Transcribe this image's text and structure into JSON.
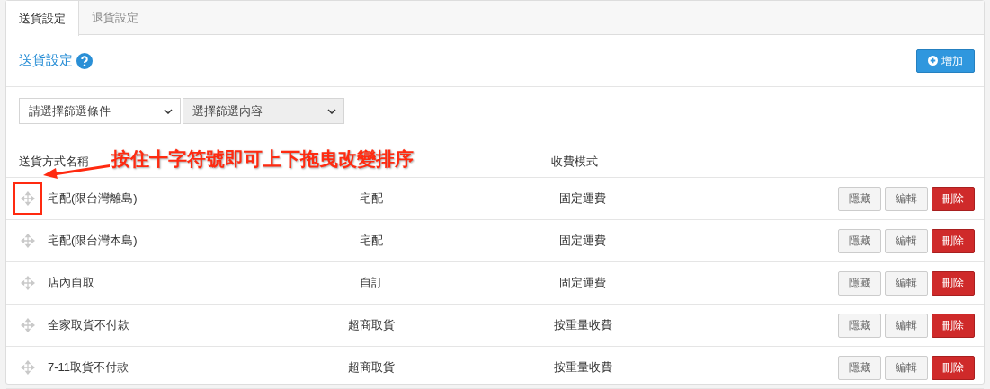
{
  "tabs": [
    {
      "label": "送貨設定",
      "selected": true
    },
    {
      "label": "退貨設定",
      "selected": false
    }
  ],
  "panel_title": "送貨設定",
  "add_button": "增加",
  "filters": [
    {
      "value": "請選擇篩選條件",
      "disabled": false
    },
    {
      "value": "選擇篩選內容",
      "disabled": true
    }
  ],
  "table": {
    "columns": [
      "送貨方式名稱",
      "收費模式"
    ],
    "rows": [
      {
        "name": "宅配(限台灣離島)",
        "type": "宅配",
        "fee": "固定運費",
        "highlighted": true,
        "actions": [
          "隱藏",
          "編輯",
          "刪除"
        ]
      },
      {
        "name": "宅配(限台灣本島)",
        "type": "宅配",
        "fee": "固定運費",
        "highlighted": false,
        "actions": [
          "隱藏",
          "編輯",
          "刪除"
        ]
      },
      {
        "name": "店內自取",
        "type": "自訂",
        "fee": "固定運費",
        "highlighted": false,
        "actions": [
          "隱藏",
          "編輯",
          "刪除"
        ]
      },
      {
        "name": "全家取貨不付款",
        "type": "超商取貨",
        "fee": "按重量收費",
        "highlighted": false,
        "actions": [
          "隱藏",
          "編輯",
          "刪除"
        ]
      },
      {
        "name": "7-11取貨不付款",
        "type": "超商取貨",
        "fee": "按重量收費",
        "highlighted": false,
        "actions": [
          "隱藏",
          "編輯",
          "刪除"
        ]
      }
    ]
  },
  "annotation": "按住十字符號即可上下拖曳改變排序"
}
